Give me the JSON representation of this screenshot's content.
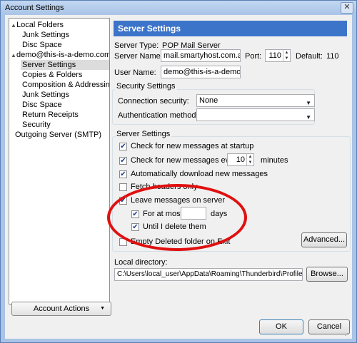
{
  "window": {
    "title": "Account Settings",
    "close_glyph": "✕"
  },
  "tree": {
    "items": [
      {
        "label": "Local Folders",
        "level": 0,
        "expanded": true
      },
      {
        "label": "Junk Settings",
        "level": 1
      },
      {
        "label": "Disc Space",
        "level": 1
      },
      {
        "label": "demo@this-is-a-demo.com",
        "level": 0,
        "expanded": true
      },
      {
        "label": "Server Settings",
        "level": 1,
        "selected": true
      },
      {
        "label": "Copies & Folders",
        "level": 1
      },
      {
        "label": "Composition & Addressing",
        "level": 1
      },
      {
        "label": "Junk Settings",
        "level": 1
      },
      {
        "label": "Disc Space",
        "level": 1
      },
      {
        "label": "Return Receipts",
        "level": 1
      },
      {
        "label": "Security",
        "level": 1
      },
      {
        "label": "Outgoing Server (SMTP)",
        "level": 0
      }
    ],
    "account_actions_label": "Account Actions"
  },
  "panel": {
    "header": "Server Settings",
    "server_type_label": "Server Type:",
    "server_type_value": "POP Mail Server",
    "server_name_label": "Server Name:",
    "server_name_value": "mail.smartyhost.com.au",
    "port_label": "Port:",
    "port_value": "110",
    "default_label": "Default:",
    "default_value": "110",
    "user_name_label": "User Name:",
    "user_name_value": "demo@this-is-a-demo.co",
    "security_group_title": "Security Settings",
    "connection_security_label": "Connection security:",
    "connection_security_value": "None",
    "auth_method_label": "Authentication method:",
    "auth_method_value": "",
    "server_group_title": "Server Settings",
    "check_startup_label": "Check for new messages at startup",
    "check_every_label": "Check for new messages every",
    "check_every_value": "10",
    "minutes_label": "minutes",
    "auto_download_label": "Automatically download new messages",
    "fetch_headers_label": "Fetch headers only",
    "leave_messages_label": "Leave messages on server",
    "for_at_most_label": "For at most",
    "for_at_most_value": "",
    "days_label": "days",
    "until_delete_label": "Until I delete them",
    "empty_deleted_label": "Empty Deleted folder on Exit",
    "advanced_button": "Advanced...",
    "local_dir_label": "Local directory:",
    "local_dir_value": "C:\\Users\\local_user\\AppData\\Roaming\\Thunderbird\\Profiles\\",
    "browse_button": "Browse..."
  },
  "footer": {
    "ok_label": "OK",
    "cancel_label": "Cancel"
  },
  "checkboxes": {
    "check_startup": true,
    "check_every": true,
    "auto_download": true,
    "fetch_headers": false,
    "leave_messages": true,
    "for_at_most": true,
    "until_delete": true,
    "empty_deleted": false
  },
  "colors": {
    "header_bg": "#3c74c9",
    "highlight_ellipse": "#e01010",
    "window_frame": "#a9c4e6"
  }
}
